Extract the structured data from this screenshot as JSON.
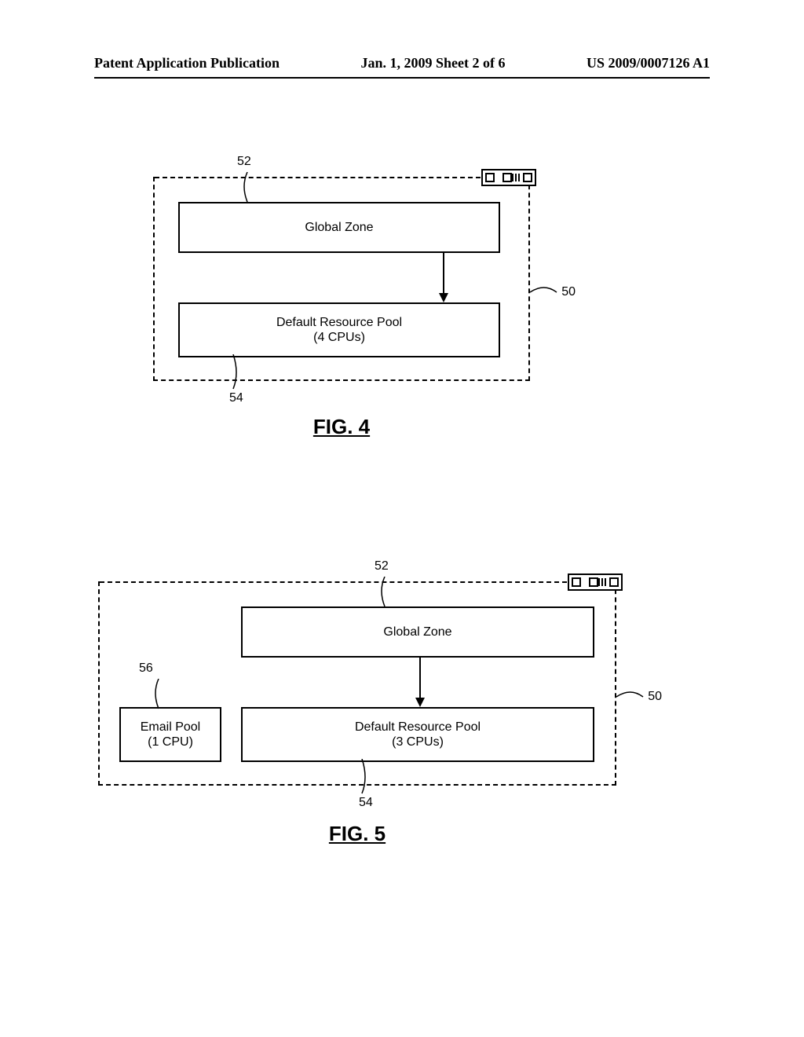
{
  "header": {
    "left": "Patent Application Publication",
    "center": "Jan. 1, 2009  Sheet 2 of 6",
    "right": "US 2009/0007126 A1"
  },
  "fig4": {
    "caption": "FIG. 4",
    "global_zone": "Global Zone",
    "default_pool_line1": "Default Resource Pool",
    "default_pool_line2": "(4 CPUs)",
    "ref50": "50",
    "ref52": "52",
    "ref54": "54"
  },
  "fig5": {
    "caption": "FIG. 5",
    "global_zone": "Global Zone",
    "default_pool_line1": "Default Resource Pool",
    "default_pool_line2": "(3 CPUs)",
    "email_pool_line1": "Email Pool",
    "email_pool_line2": "(1 CPU)",
    "ref50": "50",
    "ref52": "52",
    "ref54": "54",
    "ref56": "56"
  }
}
